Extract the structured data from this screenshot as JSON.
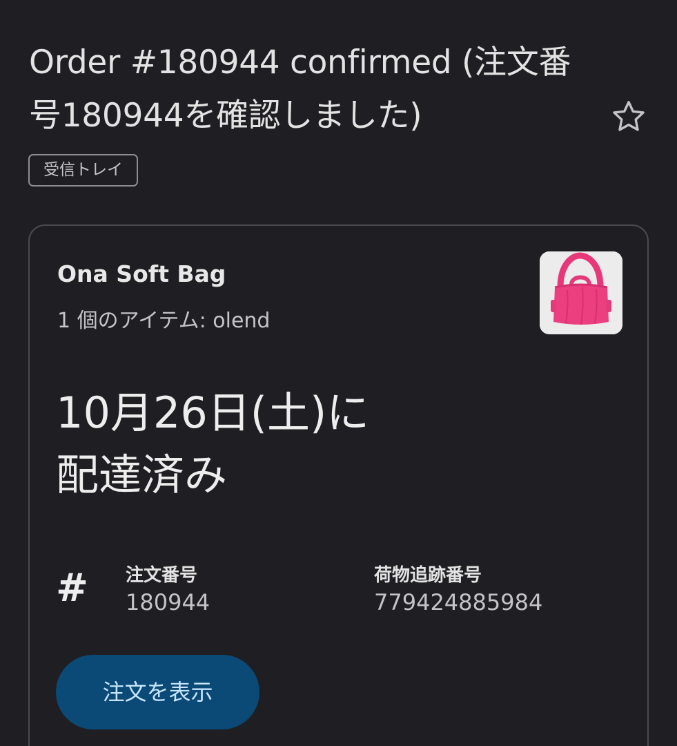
{
  "email": {
    "subject": "Order #180944 confirmed (注文番号180944を確認しました)",
    "label": "受信トレイ",
    "star_icon": "star-outline-icon"
  },
  "order_card": {
    "product_name": "Ona Soft Bag",
    "item_summary": "1 個のアイテム: olend",
    "thumbnail": "pink-soft-bag-image",
    "delivery_status_line1": "10月26日(土)に",
    "delivery_status_line2": "配達済み",
    "order_number_icon": "hash-icon",
    "order_number_label": "注文番号",
    "order_number_value": "180944",
    "tracking_label": "荷物追跡番号",
    "tracking_value": "779424885984",
    "view_order_button": "注文を表示"
  },
  "colors": {
    "background": "#1f1f23",
    "card_border": "#4a4a50",
    "button_bg": "#0b4a76",
    "button_text": "#c8e6ff",
    "bag_pink": "#ec3f80"
  }
}
